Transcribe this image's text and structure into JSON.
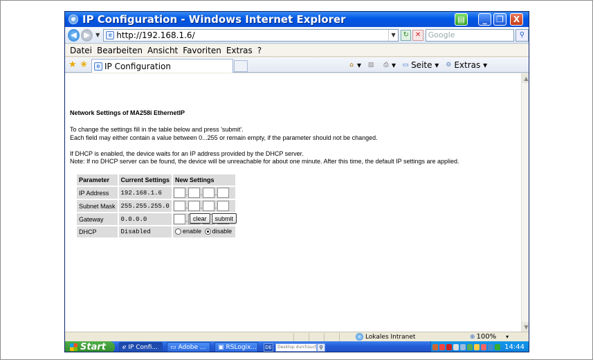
{
  "window": {
    "title": "IP Configuration - Windows Internet Explorer",
    "min_glyph": "_",
    "max_glyph": "❐",
    "close_glyph": "X"
  },
  "addressbar": {
    "url": "http://192.168.1.6/",
    "search_placeholder": "Google"
  },
  "menu": {
    "items": [
      "Datei",
      "Bearbeiten",
      "Ansicht",
      "Favoriten",
      "Extras",
      "?"
    ]
  },
  "tab": {
    "label": "IP Configuration"
  },
  "commandbar": {
    "seite": "Seite ▾",
    "extras": "Extras ▾"
  },
  "page": {
    "heading": "Network Settings of MA258i EthernetIP",
    "instruction_1": "To change the settings fill in the table below and press 'submit'.",
    "instruction_2": "Each field may either contain a value between 0...255 or remain empty, if the parameter should not be changed.",
    "dhcp_note_1": "If DHCP is enabled, the device waits for an IP address provided by the DHCP server.",
    "dhcp_note_2": "Note: If no DHCP server can be found, the device will be unreachable for about one minute. After this time, the default IP settings are applied.",
    "table": {
      "headers": [
        "Parameter",
        "Current Settings",
        "New Settings"
      ],
      "rows": [
        {
          "param": "IP Address",
          "current": "192.168.1.6"
        },
        {
          "param": "Subnet Mask",
          "current": "255.255.255.0"
        },
        {
          "param": "Gateway",
          "current": "0.0.0.0"
        },
        {
          "param": "DHCP",
          "current": "Disabled"
        }
      ],
      "dhcp_options": {
        "enable": "enable",
        "disable": "disable",
        "selected": "disable"
      }
    },
    "buttons": {
      "clear": "clear",
      "submit": "submit"
    }
  },
  "statusbar": {
    "zone": "Lokales Intranet",
    "zoom": "100%"
  },
  "taskbar": {
    "start": "Start",
    "tasks": [
      "IP Confi...",
      "Adobe ...",
      "RSLogix..."
    ],
    "lang": "DE",
    "desktop_search_placeholder": "Desktop durchsuche",
    "clock": "14:44"
  },
  "colors": {
    "titlebar": "#0058e6",
    "table_cell": "#dcdcdc",
    "start": "#3c9a34",
    "taskbar": "#245dd7"
  }
}
